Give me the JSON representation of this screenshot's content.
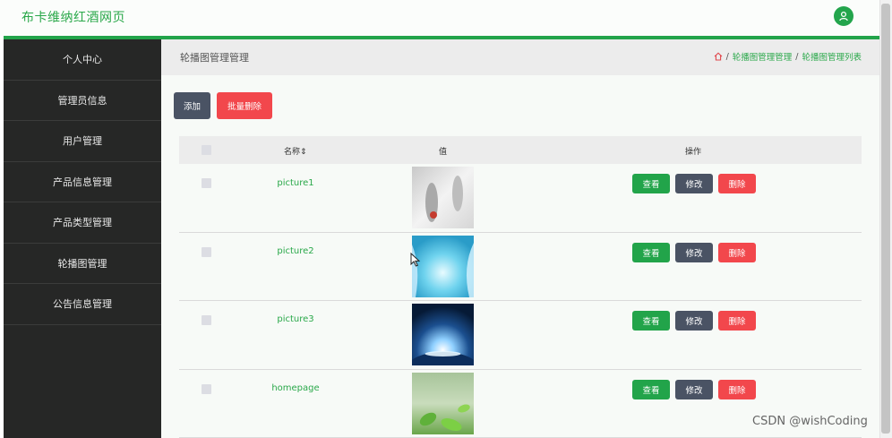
{
  "app": {
    "title": "布卡维纳红酒网页"
  },
  "sidebar": {
    "items": [
      {
        "label": "个人中心"
      },
      {
        "label": "管理员信息"
      },
      {
        "label": "用户管理"
      },
      {
        "label": "产品信息管理"
      },
      {
        "label": "产品类型管理"
      },
      {
        "label": "轮播图管理"
      },
      {
        "label": "公告信息管理"
      }
    ]
  },
  "page": {
    "title": "轮播图管理管理",
    "breadcrumb": [
      "轮播图管理管理",
      "轮播图管理列表"
    ],
    "separator": "/"
  },
  "toolbar": {
    "add_label": "添加",
    "batch_delete_label": "批量删除"
  },
  "table": {
    "columns": {
      "name": "名称",
      "sort_glyph": "⇕",
      "value": "值",
      "actions": "操作"
    },
    "rows": [
      {
        "name": "picture1"
      },
      {
        "name": "picture2"
      },
      {
        "name": "picture3"
      },
      {
        "name": "homepage"
      }
    ],
    "actions": {
      "view": "查看",
      "edit": "修改",
      "delete": "删除"
    }
  },
  "watermark": "CSDN @wishCoding",
  "colors": {
    "brand_green": "#22a44a",
    "sidebar_bg": "#262726",
    "edit_button": "#4a5364",
    "delete_button": "#f2474c"
  },
  "icons": {
    "avatar": "user-icon",
    "home": "home-icon",
    "cursor": "mouse-pointer-icon"
  }
}
